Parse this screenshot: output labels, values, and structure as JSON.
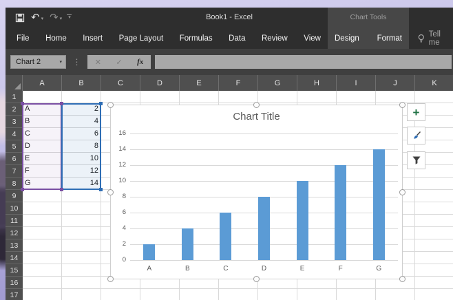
{
  "window": {
    "title": "Book1 - Excel",
    "contextual_group": "Chart Tools"
  },
  "qat": {
    "buttons": [
      "save",
      "undo",
      "redo",
      "customize-quick-access-toolbar"
    ]
  },
  "ribbon": {
    "tabs": [
      "File",
      "Home",
      "Insert",
      "Page Layout",
      "Formulas",
      "Data",
      "Review",
      "View"
    ],
    "contextual_tabs": [
      "Design",
      "Format"
    ],
    "tell_me": "Tell me"
  },
  "formula_bar": {
    "name_box": "Chart 2",
    "fx_label": "fx",
    "formula_value": ""
  },
  "icons": {
    "undo": "↶",
    "redo": "↷",
    "dropdown": "▾",
    "dots": "⋮",
    "cancel": "✕",
    "check": "✓",
    "plus": "+"
  },
  "sheet": {
    "columns": [
      "A",
      "B",
      "C",
      "D",
      "E",
      "F",
      "G",
      "H",
      "I",
      "J",
      "K"
    ],
    "row_count": 17,
    "cells": [
      {
        "row": 2,
        "col": "A",
        "v": "A"
      },
      {
        "row": 2,
        "col": "B",
        "v": "2"
      },
      {
        "row": 3,
        "col": "A",
        "v": "B"
      },
      {
        "row": 3,
        "col": "B",
        "v": "4"
      },
      {
        "row": 4,
        "col": "A",
        "v": "C"
      },
      {
        "row": 4,
        "col": "B",
        "v": "6"
      },
      {
        "row": 5,
        "col": "A",
        "v": "D"
      },
      {
        "row": 5,
        "col": "B",
        "v": "8"
      },
      {
        "row": 6,
        "col": "A",
        "v": "E"
      },
      {
        "row": 6,
        "col": "B",
        "v": "10"
      },
      {
        "row": 7,
        "col": "A",
        "v": "F"
      },
      {
        "row": 7,
        "col": "B",
        "v": "12"
      },
      {
        "row": 8,
        "col": "A",
        "v": "G"
      },
      {
        "row": 8,
        "col": "B",
        "v": "14"
      }
    ],
    "selection": {
      "category_range": "A2:A8",
      "value_range": "B2:B8"
    }
  },
  "chart_data": {
    "type": "bar",
    "title": "Chart Title",
    "categories": [
      "A",
      "B",
      "C",
      "D",
      "E",
      "F",
      "G"
    ],
    "values": [
      2,
      4,
      6,
      8,
      10,
      12,
      14
    ],
    "xlabel": "",
    "ylabel": "",
    "ylim": [
      0,
      16
    ],
    "ytick_step": 2,
    "grid": true,
    "legend": "none",
    "bar_color": "#5b9bd5"
  },
  "chart_buttons": [
    "chart-elements",
    "chart-styles",
    "chart-filters"
  ],
  "colors": {
    "bar": "#5b9bd5",
    "category_range": "#7a4fa3",
    "value_range": "#2f6eb5",
    "chart_text": "#595959",
    "titlebar": "#2e2e2e",
    "contextual_bg": "#474747"
  }
}
